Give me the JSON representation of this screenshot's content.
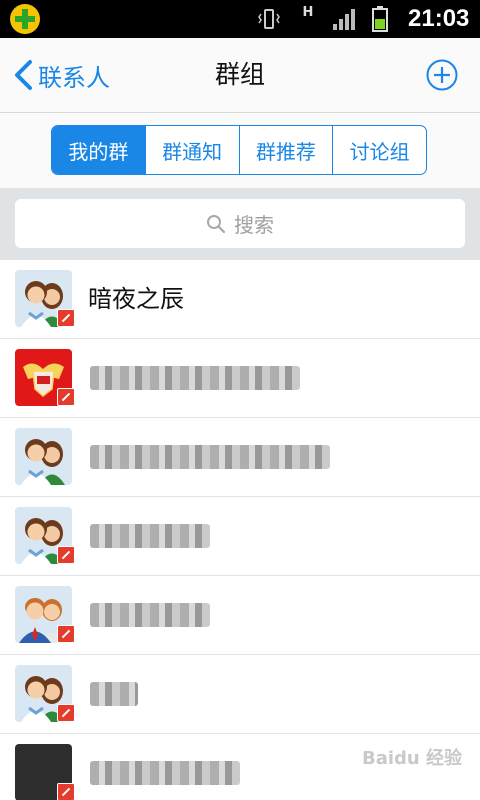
{
  "status_bar": {
    "time": "21:03",
    "network_type": "H",
    "colors": {
      "logo": "#f5c400",
      "battery": "#7ed321"
    }
  },
  "nav": {
    "back_label": "联系人",
    "title": "群组",
    "add_icon": "plus-circle-icon",
    "accent_color": "#1a86e6"
  },
  "tabs": [
    {
      "label": "我的群",
      "active": true
    },
    {
      "label": "群通知",
      "active": false
    },
    {
      "label": "群推荐",
      "active": false
    },
    {
      "label": "讨论组",
      "active": false
    }
  ],
  "search": {
    "placeholder": "搜索"
  },
  "groups": [
    {
      "name": "暗夜之辰",
      "avatar": "couple-avatar",
      "blocked": true
    },
    {
      "name": "",
      "avatar": "red-crest-avatar",
      "blocked": true,
      "name_obscured": true
    },
    {
      "name": "",
      "avatar": "couple-avatar",
      "blocked": false,
      "name_obscured": true
    },
    {
      "name": "",
      "avatar": "couple-avatar",
      "blocked": true,
      "name_obscured": true
    },
    {
      "name": "",
      "avatar": "business-couple-avatar",
      "blocked": true,
      "name_obscured": true
    },
    {
      "name": "",
      "avatar": "couple-avatar",
      "blocked": true,
      "name_obscured": true
    },
    {
      "name": "",
      "avatar": "dark-avatar",
      "blocked": true,
      "name_obscured": true
    }
  ],
  "watermark": "Baidu 经验"
}
